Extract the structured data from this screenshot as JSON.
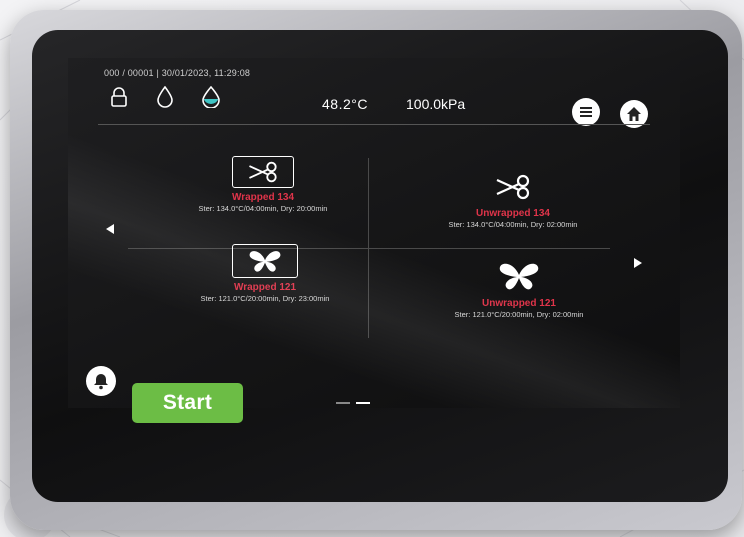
{
  "status": {
    "counter": "000 / 00001",
    "datetime": "30/01/2023, 11:29:08",
    "pressure": "100.0kPa",
    "temperature": "48.2°C"
  },
  "icons": {
    "top_left": [
      "lock-icon",
      "water-drop-outline-icon",
      "water-drop-half-icon"
    ],
    "top_right": [
      "menu-icon",
      "home-icon"
    ],
    "bottom": [
      "bell-icon"
    ]
  },
  "programs": [
    {
      "name": "Unwrapped 134",
      "details": "Ster: 134.0°C/04:00min, Dry: 02:00min",
      "icon": "scissors-icon",
      "boxed": false
    },
    {
      "name": "Wrapped 134",
      "details": "Ster: 134.0°C/04:00min, Dry: 20:00min",
      "icon": "scissors-icon",
      "boxed": true
    },
    {
      "name": "Unwrapped 121",
      "details": "Ster: 121.0°C/20:00min, Dry: 02:00min",
      "icon": "butterfly-icon",
      "boxed": false
    },
    {
      "name": "Wrapped 121",
      "details": "Ster: 121.0°C/20:00min, Dry: 23:00min",
      "icon": "butterfly-icon",
      "boxed": true
    }
  ],
  "pager": {
    "pages": 2,
    "active": 2
  },
  "start_button": {
    "label": "Start"
  },
  "colors": {
    "accent_red": "#e0344a",
    "start_green": "#6cbd45",
    "water_teal": "#3fc4c4"
  }
}
